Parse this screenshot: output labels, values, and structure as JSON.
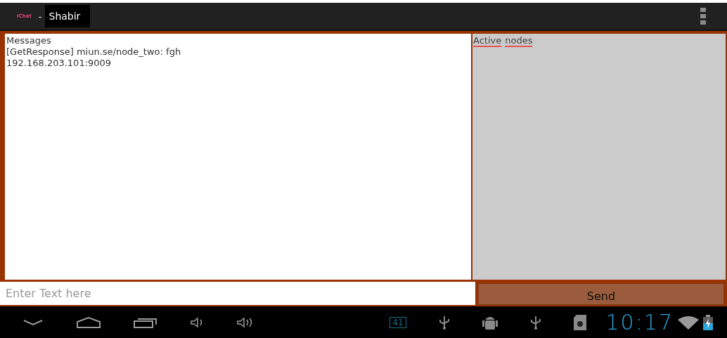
{
  "action_bar": {
    "app_name": "IChat",
    "separator": "-",
    "user": "Shabir"
  },
  "messages": {
    "heading": "Messages",
    "lines": [
      "[GetResponse] miun.se/node_two: fgh",
      "192.168.203.101:9009"
    ]
  },
  "nodes": {
    "heading_words": [
      "Active",
      "nodes"
    ]
  },
  "input": {
    "placeholder": "Enter Text here"
  },
  "send_button": {
    "label": "Send"
  },
  "status_bar": {
    "notification_count": "41",
    "time": "10:17"
  }
}
